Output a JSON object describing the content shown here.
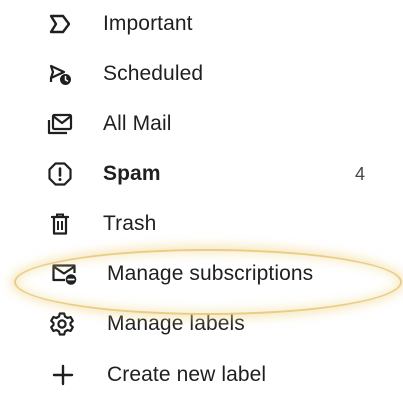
{
  "nav": {
    "items": [
      {
        "label": "Important",
        "icon": "important-icon"
      },
      {
        "label": "Scheduled",
        "icon": "scheduled-send-icon"
      },
      {
        "label": "All Mail",
        "icon": "all-mail-icon"
      },
      {
        "label": "Spam",
        "icon": "spam-icon",
        "count": "4",
        "bold": true
      },
      {
        "label": "Trash",
        "icon": "trash-icon"
      },
      {
        "label": "Manage subscriptions",
        "icon": "manage-subscriptions-icon",
        "highlighted": true
      },
      {
        "label": "Manage labels",
        "icon": "gear-icon"
      },
      {
        "label": "Create new label",
        "icon": "plus-icon"
      }
    ]
  },
  "colors": {
    "text": "#1f1f1f",
    "count": "#444746",
    "highlight": "#e6c46e",
    "background": "#ffffff"
  }
}
